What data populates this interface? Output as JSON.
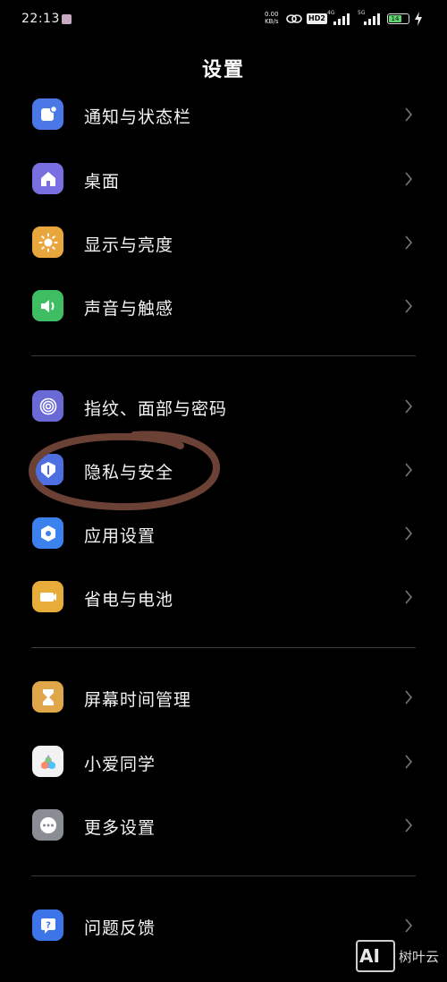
{
  "status": {
    "time": "22:13",
    "net_speed_value": "0.00",
    "net_speed_unit": "KB/s",
    "hd_badge": "HD2",
    "signal1_label": "4G",
    "signal2_label": "5G",
    "battery_level": "14",
    "battery_percent": 14,
    "battery_color": "#5cd66a"
  },
  "header": {
    "title": "设置"
  },
  "settings": [
    {
      "label": "通知与状态栏",
      "icon": "notification-icon",
      "color": "#4a78e6"
    },
    {
      "label": "桌面",
      "icon": "home-icon",
      "color": "#7a6fe0"
    },
    {
      "label": "显示与亮度",
      "icon": "sun-icon",
      "color": "#e9a63c"
    },
    {
      "label": "声音与触感",
      "icon": "speaker-icon",
      "color": "#3fbd63"
    },
    {
      "label": "指纹、面部与密码",
      "icon": "fingerprint-icon",
      "color": "#6a6ad6"
    },
    {
      "label": "隐私与安全",
      "icon": "shield-icon",
      "color": "#4e6fe0"
    },
    {
      "label": "应用设置",
      "icon": "app-gear-icon",
      "color": "#3c82ee"
    },
    {
      "label": "省电与电池",
      "icon": "battery-icon",
      "color": "#e8ac3a"
    },
    {
      "label": "屏幕时间管理",
      "icon": "hourglass-icon",
      "color": "#e0a64a"
    },
    {
      "label": "小爱同学",
      "icon": "assistant-icon",
      "color": "#f2f2f2"
    },
    {
      "label": "更多设置",
      "icon": "more-icon",
      "color": "#8a8d93"
    },
    {
      "label": "问题反馈",
      "icon": "feedback-icon",
      "color": "#3d75e8"
    }
  ],
  "annotation": {
    "color": "#6b4035"
  },
  "watermark": {
    "logo": "AI",
    "text": "树叶云"
  }
}
